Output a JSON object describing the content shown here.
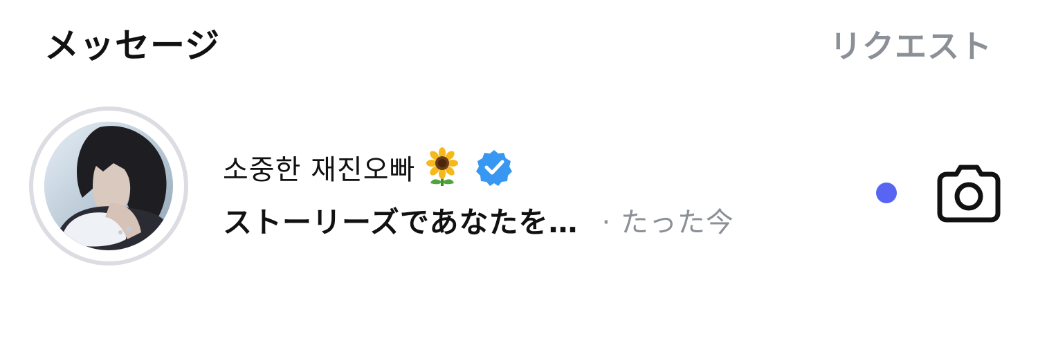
{
  "header": {
    "title": "メッセージ",
    "requests_label": "リクエスト"
  },
  "thread": {
    "name": "소중한 재진오빠",
    "name_emoji": "sunflower-icon",
    "verified_icon": "verified-badge-icon",
    "preview": "ストーリーズであなたを…",
    "time": "· たった今",
    "unread": true,
    "action_icon": "camera-icon",
    "colors": {
      "unread_dot": "#5865f2",
      "verified": "#3897f0",
      "secondary_text": "#8b8f96",
      "ring": "#dcdde2"
    }
  }
}
